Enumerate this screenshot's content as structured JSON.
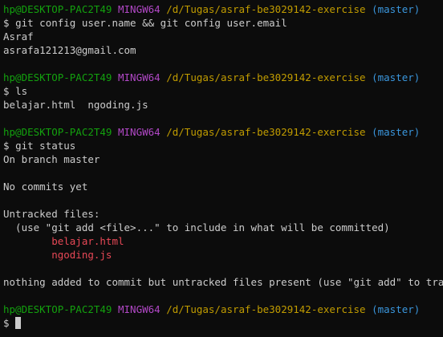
{
  "prompt": {
    "user": "hp@DESKTOP-PAC2T49",
    "system": "MINGW64",
    "path": "/d/Tugas/asraf-be3029142-exercise",
    "branch": "(master)",
    "symbol": "$"
  },
  "blocks": [
    {
      "command": "git config user.name && git config user.email",
      "output": [
        {
          "text": "Asraf",
          "style": "plain"
        },
        {
          "text": "asrafa121213@gmail.com",
          "style": "plain"
        }
      ]
    },
    {
      "command": "ls",
      "output": [
        {
          "text": "belajar.html  ngoding.js",
          "style": "plain"
        }
      ]
    },
    {
      "command": "git status",
      "output": [
        {
          "text": "On branch master",
          "style": "plain"
        },
        {
          "text": "",
          "style": "plain"
        },
        {
          "text": "No commits yet",
          "style": "plain"
        },
        {
          "text": "",
          "style": "plain"
        },
        {
          "text": "Untracked files:",
          "style": "plain"
        },
        {
          "text": "  (use \"git add <file>...\" to include in what will be committed)",
          "style": "plain"
        },
        {
          "text": "        belajar.html",
          "style": "red"
        },
        {
          "text": "        ngoding.js",
          "style": "red"
        },
        {
          "text": "",
          "style": "plain"
        },
        {
          "text": "nothing added to commit but untracked files present (use \"git add\" to track)",
          "style": "plain"
        }
      ]
    }
  ],
  "colors": {
    "background": "#0c0c0c",
    "text": "#cccccc",
    "user": "#13a10e",
    "system": "#b148c6",
    "path": "#c19c00",
    "branch": "#3a96dd",
    "untracked": "#e74856"
  }
}
